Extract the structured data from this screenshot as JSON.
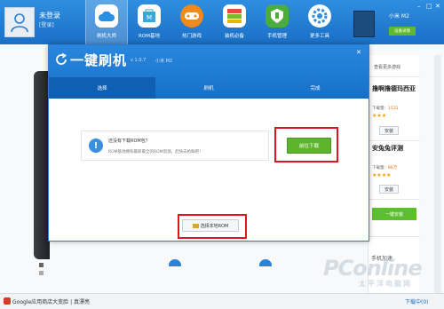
{
  "user": {
    "name": "未登录",
    "login_link": "[登录]"
  },
  "nav": [
    {
      "label": "刷机大师",
      "icon": "cloud-icon",
      "color": "#2a8ee2",
      "active": true
    },
    {
      "label": "ROM基地",
      "icon": "rom-bag-icon",
      "color": "#ffffff"
    },
    {
      "label": "热门游戏",
      "icon": "gamepad-icon",
      "color": "#f08a1c"
    },
    {
      "label": "装机必备",
      "icon": "app-grid-icon",
      "color": "#7ab932"
    },
    {
      "label": "手机管理",
      "icon": "shield-icon",
      "color": "#4cae3a"
    },
    {
      "label": "更多工具",
      "icon": "gear-icon",
      "color": "#2a8ee2"
    }
  ],
  "device": {
    "name": "小米 M2",
    "button": "设备详情"
  },
  "dialog": {
    "title": "一键刷机",
    "version": "v 1.0.7",
    "model": "小米 M2",
    "steps": [
      "选择",
      "刷机",
      "完成"
    ],
    "info_title": "还没有下载ROM包？",
    "info_desc": "ROM基地拥有最新最全的ROM资源，赶快去抢鲜吧！",
    "download_btn": "前往下载",
    "local_btn": "选择本地ROM"
  },
  "right_panel": {
    "title": "查看更多游戏",
    "games": [
      {
        "name": "撸啊撸德玛西亚",
        "downloads_label": "下载量：",
        "downloads": "1531",
        "stars": "★★★",
        "button": "安装"
      },
      {
        "name": "安兔兔评测",
        "downloads_label": "下载量：",
        "downloads": "86万",
        "stars": "★★★★",
        "button": "安装"
      }
    ],
    "install_btn": "一键安装",
    "bottom_text": "手机加速"
  },
  "status": {
    "text": "Google应用商店大变脸 | 真漂亮"
  },
  "download_center": "下载中(0)",
  "watermark": {
    "main": "PConline",
    "sub": "太平洋电脑网"
  }
}
